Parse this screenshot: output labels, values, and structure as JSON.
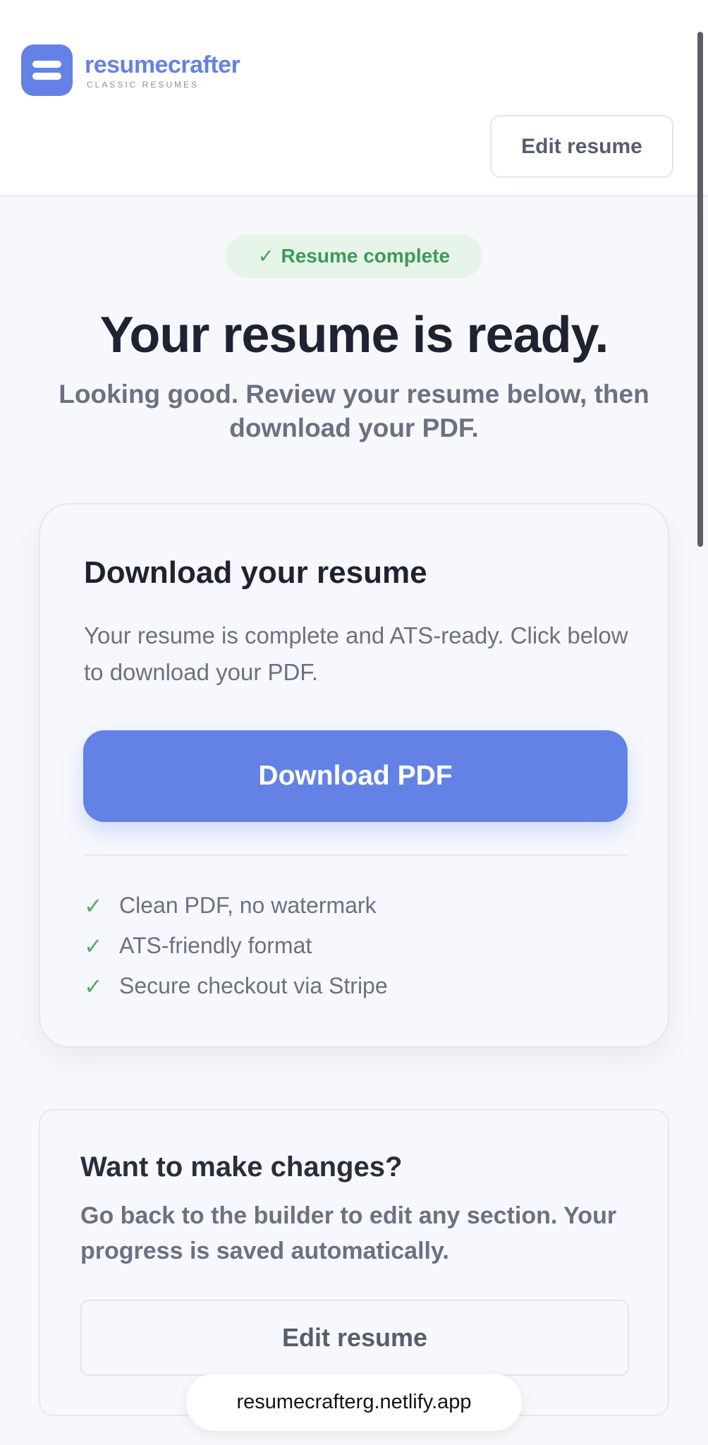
{
  "header": {
    "brand_name": "resumecrafter",
    "brand_tagline": "CLASSIC RESUMES",
    "edit_button_label": "Edit resume"
  },
  "hero": {
    "badge_check": "✓",
    "badge_label": "Resume complete",
    "title": "Your resume is ready.",
    "subtitle": "Looking good. Review your resume below, then download your PDF."
  },
  "download_card": {
    "title": "Download your resume",
    "description": "Your resume is complete and ATS-ready. Click below to download your PDF.",
    "button_label": "Download PDF",
    "features": [
      {
        "check": "✓",
        "label": "Clean PDF, no watermark"
      },
      {
        "check": "✓",
        "label": "ATS-friendly format"
      },
      {
        "check": "✓",
        "label": "Secure checkout via Stripe"
      }
    ]
  },
  "changes_card": {
    "title": "Want to make changes?",
    "description": "Go back to the builder to edit any section. Your progress is saved automatically.",
    "button_label": "Edit resume"
  },
  "browser": {
    "url": "resumecrafterg.netlify.app"
  },
  "colors": {
    "accent": "#6482e6",
    "success": "#3e9a57",
    "success_bg": "#e6f4e9",
    "text_primary": "#1f2230",
    "text_muted": "#6b7183"
  }
}
